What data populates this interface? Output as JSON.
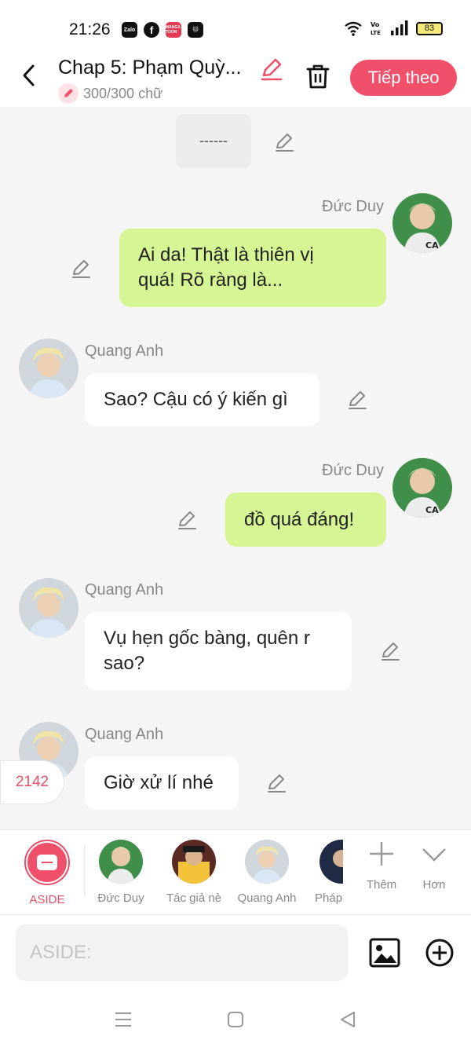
{
  "status": {
    "time": "21:26",
    "battery": "83",
    "apps": [
      "Zalo",
      "f",
      "MANGA TOON",
      "🐱"
    ]
  },
  "header": {
    "title": "Chap 5: Phạm Quỳ...",
    "word_count": "300/300 chữ",
    "next_label": "Tiếp theo"
  },
  "chat": {
    "aside_text": "------",
    "messages": [
      {
        "side": "right",
        "name": "Đức Duy",
        "lines": [
          "Ai da! Thật là thiên vị",
          "quá! Rõ ràng là..."
        ]
      },
      {
        "side": "left",
        "name": "Quang Anh",
        "lines": [
          "Sao? Cậu có ý kiến gì"
        ]
      },
      {
        "side": "right",
        "name": "Đức Duy",
        "lines": [
          "đồ quá đáng!"
        ]
      },
      {
        "side": "left",
        "name": "Quang Anh",
        "lines": [
          "Vụ hẹn gốc bàng, quên r",
          "sao?"
        ]
      },
      {
        "side": "left",
        "name": "Quang Anh",
        "lines": [
          "Giờ xử lí nhé"
        ]
      }
    ]
  },
  "count_badge": "2142",
  "characters": [
    {
      "label": "ASIDE"
    },
    {
      "label": "Đức Duy"
    },
    {
      "label": "Tác giả nè"
    },
    {
      "label": "Quang Anh"
    },
    {
      "label": "Pháp"
    }
  ],
  "actions": {
    "add": "Thêm",
    "more": "Hơn"
  },
  "input": {
    "placeholder": "ASIDE:"
  }
}
